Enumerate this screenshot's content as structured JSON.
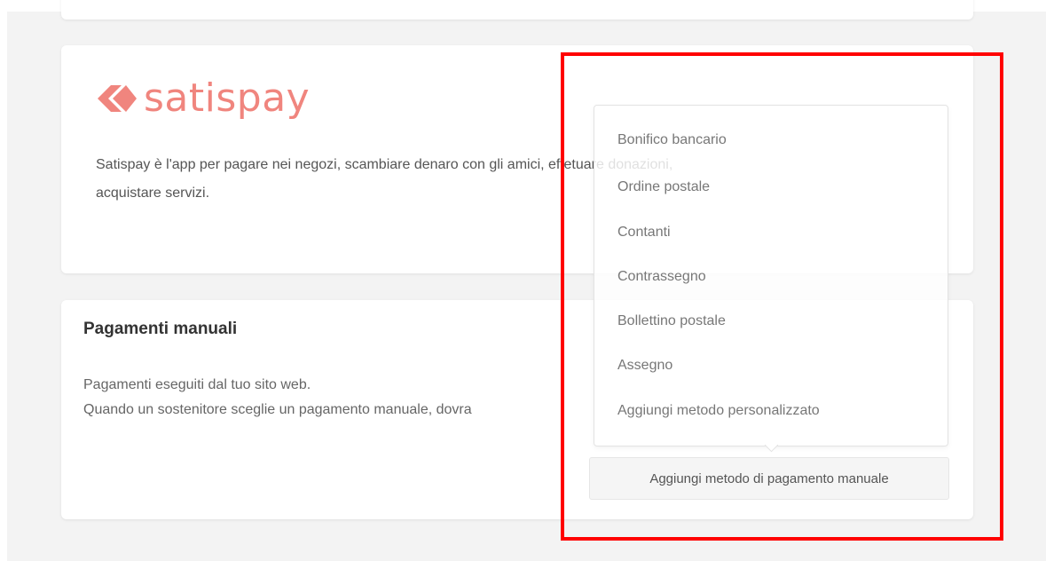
{
  "satispay": {
    "logo_text": "satispay",
    "brand_color": "#f0857e",
    "description_line1": "Satispay è l'app per pagare nei negozi, scambiare denaro con gli amici, effetuare donazioni,",
    "description_line2": "acquistare servizi."
  },
  "manual": {
    "title": "Pagamenti manuali",
    "description_line1": "Pagamenti eseguiti dal tuo sito web.",
    "description_line2": "Quando un sostenitore sceglie un pagamento manuale, dovra"
  },
  "dropdown": {
    "items": [
      "Bonifico bancario",
      "Ordine postale",
      "Contanti",
      "Contrassegno",
      "Bollettino postale",
      "Assegno",
      "Aggiungi metodo personalizzato"
    ]
  },
  "add_button_label": "Aggiungi metodo di pagamento manuale",
  "highlight_color": "#ff0000"
}
